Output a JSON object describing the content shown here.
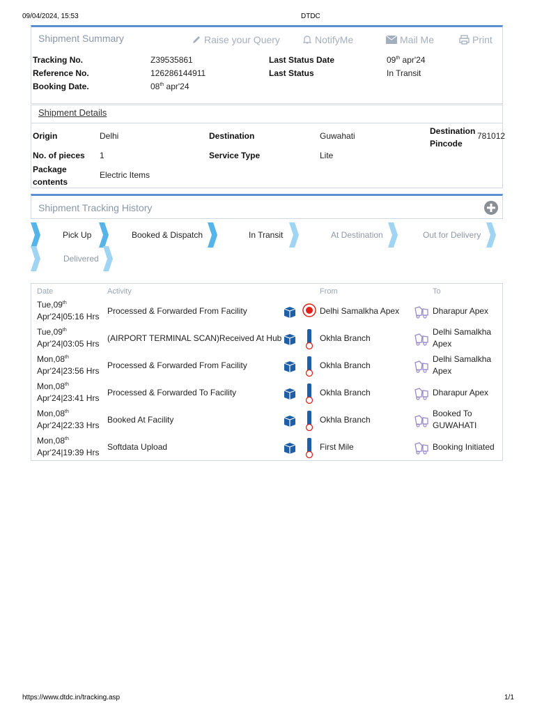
{
  "print_header": {
    "datetime": "09/04/2024, 15:53",
    "title": "DTDC"
  },
  "print_footer": {
    "url": "https://www.dtdc.in/tracking.asp",
    "page": "1/1"
  },
  "colors": {
    "accent": "#5b8fd1",
    "icon_blue": "#1f5fa8",
    "marker_red": "#e0221b",
    "muted": "#8a97a8"
  },
  "summary": {
    "title": "Shipment Summary",
    "actions": {
      "query": "Raise your Query",
      "notify": "NotifyMe",
      "mail": "Mail Me",
      "print": "Print"
    },
    "tracking_label": "Tracking No.",
    "tracking_value": "Z39535861",
    "reference_label": "Reference No.",
    "reference_value": "126286144911",
    "booking_label": "Booking Date.",
    "booking_day": "08",
    "booking_sup": "th",
    "booking_rest": " apr'24",
    "last_status_date_label": "Last Status Date",
    "last_status_day": "09",
    "last_status_sup": "th",
    "last_status_rest": " apr'24",
    "last_status_label": "Last Status",
    "last_status_value": "In Transit"
  },
  "details": {
    "title": "Shipment Details",
    "origin_label": "Origin",
    "origin_value": "Delhi",
    "destination_label": "Destination",
    "destination_value": "Guwahati",
    "pincode_label_1": "Destination",
    "pincode_label_2": "Pincode",
    "pincode_value": "781012",
    "pieces_label": "No. of pieces",
    "pieces_value": "1",
    "service_label": "Service Type",
    "service_value": "Lite",
    "contents_label_1": "Package",
    "contents_label_2": "contents",
    "contents_value": "Electric Items"
  },
  "history": {
    "title": "Shipment Tracking History",
    "steps": [
      "Pick Up",
      "Booked & Dispatch",
      "In Transit",
      "At Destination",
      "Out for Delivery",
      "Delivered"
    ],
    "completed_steps": 3,
    "columns": {
      "date": "Date",
      "activity": "Activity",
      "from": "From",
      "to": "To"
    },
    "rows": [
      {
        "d1": "Tue,09",
        "sup": "th",
        "d2": "Apr'24|05:16 Hrs",
        "activity": "Processed & Forwarded From Facility",
        "from": "Delhi Samalkha Apex",
        "to1": "Dharapur Apex",
        "to2": ""
      },
      {
        "d1": "Tue,09",
        "sup": "th",
        "d2": "Apr'24|03:05 Hrs",
        "activity": "(AIRPORT TERMINAL SCAN)Received At Hub",
        "from": "Okhla Branch",
        "to1": "Delhi Samalkha",
        "to2": "Apex"
      },
      {
        "d1": "Mon,08",
        "sup": "th",
        "d2": "Apr'24|23:56 Hrs",
        "activity": "Processed & Forwarded From Facility",
        "from": "Okhla Branch",
        "to1": "Delhi Samalkha",
        "to2": "Apex"
      },
      {
        "d1": "Mon,08",
        "sup": "th",
        "d2": "Apr'24|23:41 Hrs",
        "activity": "Processed & Forwarded To Facility",
        "from": "Okhla Branch",
        "to1": "Dharapur Apex",
        "to2": ""
      },
      {
        "d1": "Mon,08",
        "sup": "th",
        "d2": "Apr'24|22:33 Hrs",
        "activity": "Booked At Facility",
        "from": "Okhla Branch",
        "to1": "Booked To",
        "to2": "GUWAHATI"
      },
      {
        "d1": "Mon,08",
        "sup": "th",
        "d2": "Apr'24|19:39 Hrs",
        "activity": "Softdata Upload",
        "from": "First Mile",
        "to1": "Booking Initiated",
        "to2": ""
      }
    ]
  }
}
